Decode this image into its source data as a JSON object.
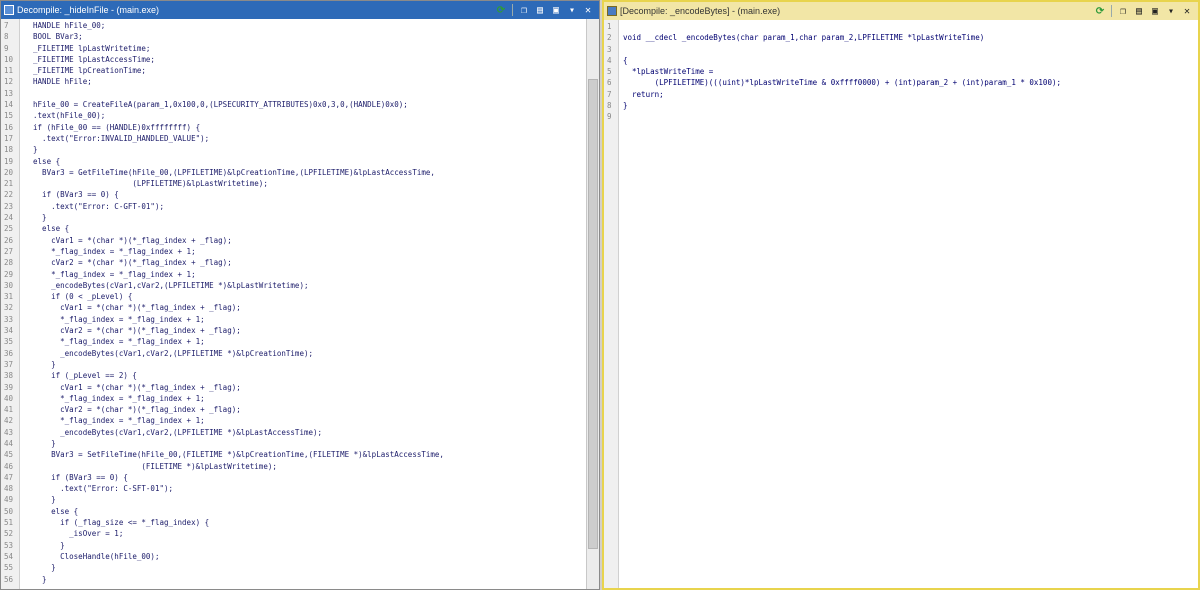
{
  "left_panel": {
    "title": "Decompile: _hideInFile -  (main.exe)",
    "lines": [
      {
        "n": "7",
        "t": "  HANDLE hFile_00;"
      },
      {
        "n": "8",
        "t": "  BOOL BVar3;"
      },
      {
        "n": "9",
        "t": "  _FILETIME lpLastWritetime;"
      },
      {
        "n": "10",
        "t": "  _FILETIME lpLastAccessTime;"
      },
      {
        "n": "11",
        "t": "  _FILETIME lpCreationTime;"
      },
      {
        "n": "12",
        "t": "  HANDLE hFile;"
      },
      {
        "n": "13",
        "t": ""
      },
      {
        "n": "14",
        "t": "  hFile_00 = CreateFileA(param_1,0x100,0,(LPSECURITY_ATTRIBUTES)0x0,3,0,(HANDLE)0x0);"
      },
      {
        "n": "15",
        "t": "  .text(hFile_00);"
      },
      {
        "n": "16",
        "t": "  if (hFile_00 == (HANDLE)0xffffffff) {"
      },
      {
        "n": "17",
        "t": "    .text(\"Error:INVALID_HANDLED_VALUE\");"
      },
      {
        "n": "18",
        "t": "  }"
      },
      {
        "n": "19",
        "t": "  else {"
      },
      {
        "n": "20",
        "t": "    BVar3 = GetFileTime(hFile_00,(LPFILETIME)&lpCreationTime,(LPFILETIME)&lpLastAccessTime,"
      },
      {
        "n": "21",
        "t": "                        (LPFILETIME)&lpLastWritetime);"
      },
      {
        "n": "22",
        "t": "    if (BVar3 == 0) {"
      },
      {
        "n": "23",
        "t": "      .text(\"Error: C-GFT-01\");"
      },
      {
        "n": "24",
        "t": "    }"
      },
      {
        "n": "25",
        "t": "    else {"
      },
      {
        "n": "26",
        "t": "      cVar1 = *(char *)(*_flag_index + _flag);"
      },
      {
        "n": "27",
        "t": "      *_flag_index = *_flag_index + 1;"
      },
      {
        "n": "28",
        "t": "      cVar2 = *(char *)(*_flag_index + _flag);"
      },
      {
        "n": "29",
        "t": "      *_flag_index = *_flag_index + 1;"
      },
      {
        "n": "30",
        "t": "      _encodeBytes(cVar1,cVar2,(LPFILETIME *)&lpLastWritetime);"
      },
      {
        "n": "31",
        "t": "      if (0 < _pLevel) {"
      },
      {
        "n": "32",
        "t": "        cVar1 = *(char *)(*_flag_index + _flag);"
      },
      {
        "n": "33",
        "t": "        *_flag_index = *_flag_index + 1;"
      },
      {
        "n": "34",
        "t": "        cVar2 = *(char *)(*_flag_index + _flag);"
      },
      {
        "n": "35",
        "t": "        *_flag_index = *_flag_index + 1;"
      },
      {
        "n": "36",
        "t": "        _encodeBytes(cVar1,cVar2,(LPFILETIME *)&lpCreationTime);"
      },
      {
        "n": "37",
        "t": "      }"
      },
      {
        "n": "38",
        "t": "      if (_pLevel == 2) {"
      },
      {
        "n": "39",
        "t": "        cVar1 = *(char *)(*_flag_index + _flag);"
      },
      {
        "n": "40",
        "t": "        *_flag_index = *_flag_index + 1;"
      },
      {
        "n": "41",
        "t": "        cVar2 = *(char *)(*_flag_index + _flag);"
      },
      {
        "n": "42",
        "t": "        *_flag_index = *_flag_index + 1;"
      },
      {
        "n": "43",
        "t": "        _encodeBytes(cVar1,cVar2,(LPFILETIME *)&lpLastAccessTime);"
      },
      {
        "n": "44",
        "t": "      }"
      },
      {
        "n": "45",
        "t": "      BVar3 = SetFileTime(hFile_00,(FILETIME *)&lpCreationTime,(FILETIME *)&lpLastAccessTime,"
      },
      {
        "n": "46",
        "t": "                          (FILETIME *)&lpLastWritetime);"
      },
      {
        "n": "47",
        "t": "      if (BVar3 == 0) {"
      },
      {
        "n": "48",
        "t": "        .text(\"Error: C-SFT-01\");"
      },
      {
        "n": "49",
        "t": "      }"
      },
      {
        "n": "50",
        "t": "      else {"
      },
      {
        "n": "51",
        "t": "        if (_flag_size <= *_flag_index) {"
      },
      {
        "n": "52",
        "t": "          _isOver = 1;"
      },
      {
        "n": "53",
        "t": "        }"
      },
      {
        "n": "54",
        "t": "        CloseHandle(hFile_00);"
      },
      {
        "n": "55",
        "t": "      }"
      },
      {
        "n": "56",
        "t": "    }"
      }
    ]
  },
  "right_panel": {
    "title": "[Decompile: _encodeBytes] -  (main.exe)",
    "lines": [
      {
        "n": "1",
        "t": ""
      },
      {
        "n": "2",
        "t": "void __cdecl _encodeBytes(char param_1,char param_2,LPFILETIME *lpLastWriteTime)"
      },
      {
        "n": "3",
        "t": ""
      },
      {
        "n": "4",
        "t": "{"
      },
      {
        "n": "5",
        "t": "  *lpLastWriteTime ="
      },
      {
        "n": "6",
        "t": "       (LPFILETIME)(((uint)*lpLastWriteTime & 0xffff0000) + (int)param_2 + (int)param_1 * 0x100);"
      },
      {
        "n": "7",
        "t": "  return;"
      },
      {
        "n": "8",
        "t": "}"
      },
      {
        "n": "9",
        "t": ""
      }
    ]
  },
  "colors": {
    "left_titlebar": "#2d6ab8",
    "right_titlebar": "#f2e6a6",
    "right_border": "#e8d44d"
  }
}
